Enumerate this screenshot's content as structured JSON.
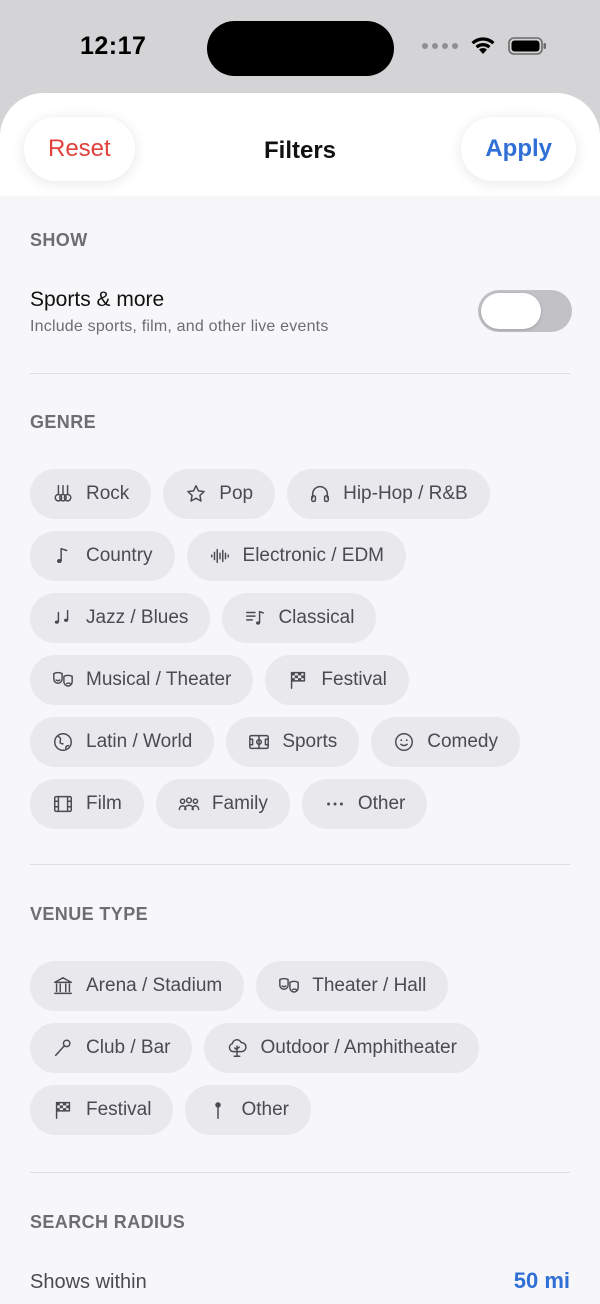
{
  "status": {
    "time": "12:17"
  },
  "header": {
    "reset_label": "Reset",
    "title": "Filters",
    "apply_label": "Apply"
  },
  "show": {
    "section_title": "SHOW",
    "toggle_title": "Sports & more",
    "toggle_subtitle": "Include sports, film, and other live events",
    "toggle_on": false
  },
  "genre": {
    "section_title": "GENRE",
    "chips": [
      {
        "label": "Rock",
        "icon": "guitars-icon"
      },
      {
        "label": "Pop",
        "icon": "star-icon"
      },
      {
        "label": "Hip-Hop / R&B",
        "icon": "headphones-icon"
      },
      {
        "label": "Country",
        "icon": "music-note-icon"
      },
      {
        "label": "Electronic / EDM",
        "icon": "waveform-icon"
      },
      {
        "label": "Jazz / Blues",
        "icon": "music-notes-icon"
      },
      {
        "label": "Classical",
        "icon": "music-list-icon"
      },
      {
        "label": "Musical / Theater",
        "icon": "theater-masks-icon"
      },
      {
        "label": "Festival",
        "icon": "checkered-flag-icon"
      },
      {
        "label": "Latin / World",
        "icon": "globe-icon"
      },
      {
        "label": "Sports",
        "icon": "sports-field-icon"
      },
      {
        "label": "Comedy",
        "icon": "smiley-icon"
      },
      {
        "label": "Film",
        "icon": "film-icon"
      },
      {
        "label": "Family",
        "icon": "people-icon"
      },
      {
        "label": "Other",
        "icon": "ellipsis-icon"
      }
    ]
  },
  "venue": {
    "section_title": "VENUE TYPE",
    "chips": [
      {
        "label": "Arena / Stadium",
        "icon": "building-columns-icon"
      },
      {
        "label": "Theater / Hall",
        "icon": "theater-masks-icon"
      },
      {
        "label": "Club / Bar",
        "icon": "microphone-icon"
      },
      {
        "label": "Outdoor / Amphitheater",
        "icon": "tree-icon"
      },
      {
        "label": "Festival",
        "icon": "checkered-flag-icon"
      },
      {
        "label": "Other",
        "icon": "pin-icon"
      }
    ]
  },
  "radius": {
    "section_title": "SEARCH RADIUS",
    "label": "Shows within",
    "value": "50 mi"
  },
  "colors": {
    "accent": "#2f6fd6",
    "destructive": "#e0413d",
    "chip_bg": "#e9e8ed"
  }
}
